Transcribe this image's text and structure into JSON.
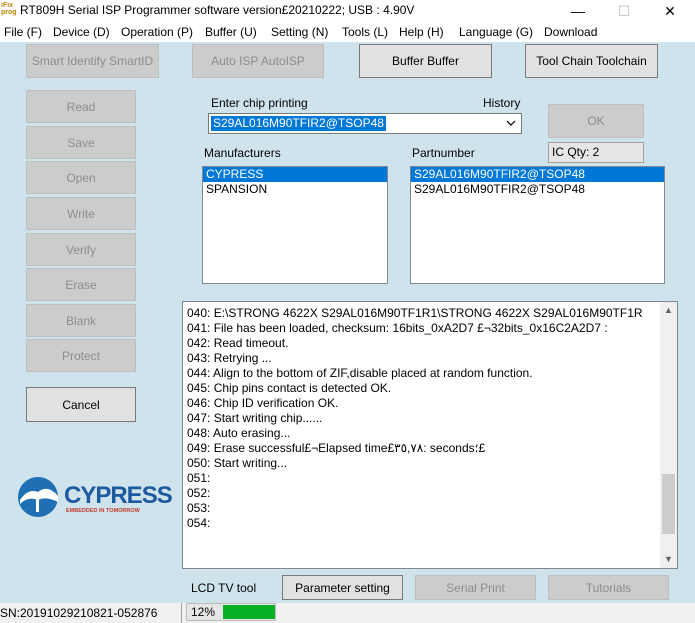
{
  "window": {
    "title": "RT809H Serial ISP Programmer software version£20210222;  USB : 4.90V",
    "app_icon_text": "iFix prog",
    "minimize": "—",
    "maximize": "☐",
    "close": "✕"
  },
  "menu": [
    "File (F)",
    "Device (D)",
    "Operation (P)",
    "Buffer (U)",
    "Setting (N)",
    "Tools (L)",
    "Help (H)",
    "Language (G)",
    "Download"
  ],
  "toolbar": {
    "smart_id": "Smart Identify SmartID",
    "auto_isp": "Auto ISP AutoISP",
    "buffer": "Buffer Buffer",
    "toolchain": "Tool Chain Toolchain"
  },
  "operations": [
    "Read",
    "Save",
    "Open",
    "Write",
    "Verify",
    "Erase",
    "Blank",
    "Protect"
  ],
  "cancel_label": "Cancel",
  "logo": {
    "brand": "CYPRESS",
    "tagline": "EMBEDDED IN TOMORROW"
  },
  "chip": {
    "enter_label": "Enter chip printing",
    "history_label": "History",
    "value": "S29AL016M90TFIR2@TSOP48",
    "ok_label": "OK",
    "ic_qty": "IC Qty: 2"
  },
  "manufacturers": {
    "label": "Manufacturers",
    "items": [
      "CYPRESS",
      "SPANSION"
    ],
    "selected": 0
  },
  "partnumber": {
    "label": "Partnumber",
    "items": [
      "S29AL016M90TFIR2@TSOP48",
      "S29AL016M90TFIR2@TSOP48"
    ],
    "selected": 0
  },
  "log": [
    "040:  E:\\STRONG 4622X  S29AL016M90TF1R1\\STRONG 4622X  S29AL016M90TF1R",
    "041:  File has been loaded, checksum: 16bits_0xA2D7 £¬32bits_0x16C2A2D7 :",
    "042:  Read timeout.",
    "043:  Retrying ...",
    "044:  Align to the bottom of ZIF,disable placed at random function.",
    "045:  Chip pins contact is detected OK.",
    "046:  Chip ID verification OK.",
    "047:  Start writing chip......",
    "048:  Auto erasing...",
    "049:  Erase successful£¬Elapsed time£٣٥,٧٨: seconds؛£",
    "050:  Start writing...",
    "051:",
    "052:",
    "053:",
    "054:"
  ],
  "bottom": {
    "lcd_label": "LCD TV tool",
    "param_btn": "Parameter setting",
    "serial_btn": "Serial Print",
    "tutorials_btn": "Tutorials"
  },
  "status": {
    "serial": "SN:20191029210821-052876",
    "progress_text": "12%",
    "progress_fraction": 0.12
  },
  "colors": {
    "accent": "#0078d7",
    "progress": "#06b025",
    "background": "#cfe3ec"
  }
}
